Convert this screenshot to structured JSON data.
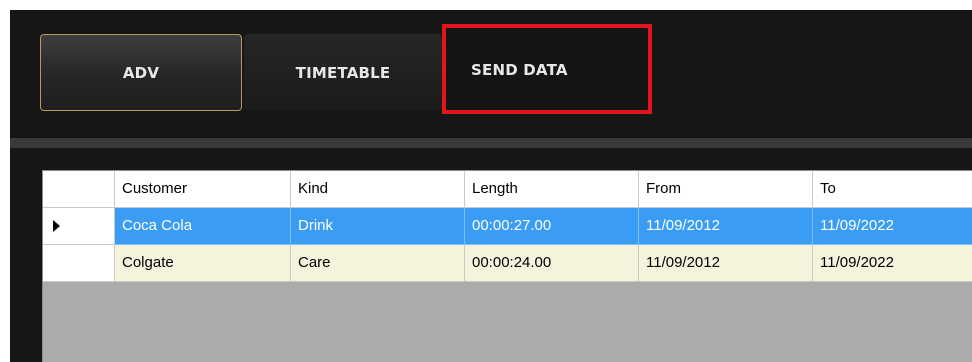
{
  "tabs": {
    "adv": "ADV",
    "timetable": "TIMETABLE",
    "send_data": "SEND DATA"
  },
  "grid": {
    "columns": [
      "Customer",
      "Kind",
      "Length",
      "From",
      "To"
    ],
    "rows": [
      {
        "customer": "Coca Cola",
        "kind": "Drink",
        "length": "00:00:27.00",
        "from": "11/09/2012",
        "to": "11/09/2022",
        "selected": true
      },
      {
        "customer": "Colgate",
        "kind": "Care",
        "length": "00:00:24.00",
        "from": "11/09/2012",
        "to": "11/09/2022",
        "selected": false
      }
    ]
  },
  "colors": {
    "background": "#161616",
    "highlight": "#e0161d",
    "selected_row": "#3a9cf2",
    "alt_row": "#f6f3dd",
    "active_tab_border": "#b89a5a"
  },
  "icons": {
    "row_selector": "triangle-right-icon"
  }
}
